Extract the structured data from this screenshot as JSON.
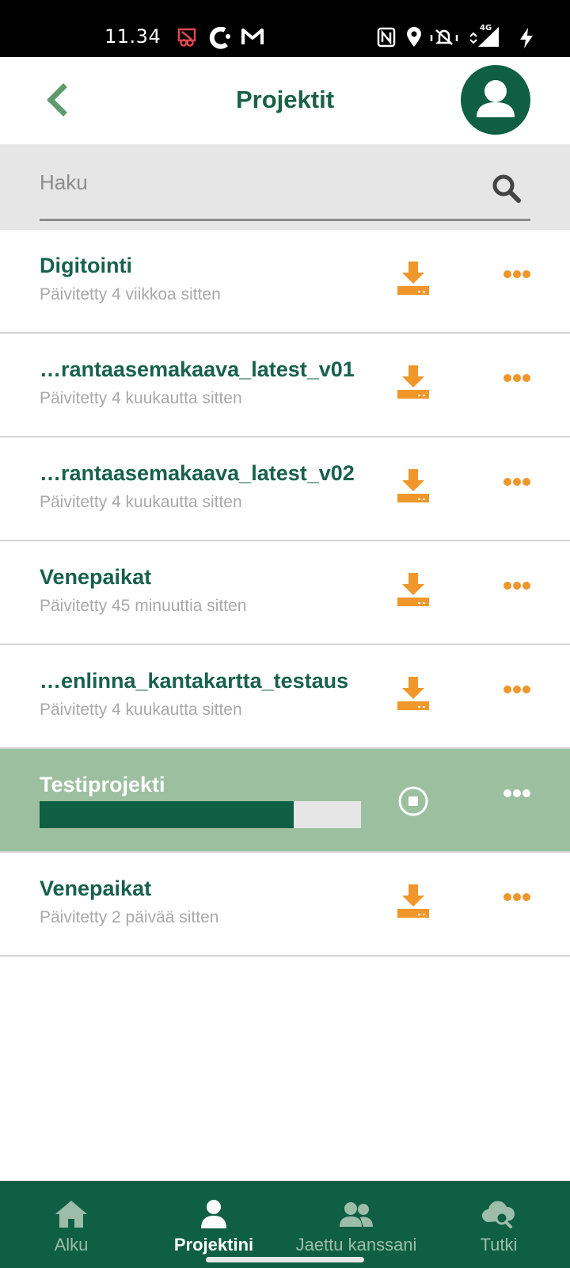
{
  "status_bar": {
    "time": "11.34",
    "icons": [
      "cast-off-icon",
      "c-app-icon",
      "gmail-icon",
      "nfc-icon",
      "location-icon",
      "vibrate-icon",
      "signal-4g-icon",
      "charging-icon"
    ]
  },
  "header": {
    "title": "Projektit",
    "back_icon": "chevron-left-icon",
    "avatar_icon": "user-avatar-icon"
  },
  "search": {
    "placeholder": "Haku",
    "value": ""
  },
  "projects": [
    {
      "name": "Digitointi",
      "updated": "Päivitetty 4 viikkoa sitten",
      "status": "download"
    },
    {
      "name": "…rantaasemakaava_latest_v01",
      "updated": "Päivitetty 4 kuukautta sitten",
      "status": "download"
    },
    {
      "name": "…rantaasemakaava_latest_v02",
      "updated": "Päivitetty 4 kuukautta sitten",
      "status": "download"
    },
    {
      "name": "Venepaikat",
      "updated": "Päivitetty 45 minuuttia sitten",
      "status": "download"
    },
    {
      "name": "…enlinna_kantakartta_testaus",
      "updated": "Päivitetty 4 kuukautta sitten",
      "status": "download"
    },
    {
      "name": "Testiprojekti",
      "updated": "",
      "status": "downloading",
      "progress": 0.79
    },
    {
      "name": "Venepaikat",
      "updated": "Päivitetty 2 päivää sitten",
      "status": "download"
    }
  ],
  "bottom_nav": {
    "items": [
      {
        "label": "Alku",
        "icon": "home-icon",
        "active": false
      },
      {
        "label": "Projektini",
        "icon": "person-icon",
        "active": true
      },
      {
        "label": "Jaettu kanssani",
        "icon": "people-icon",
        "active": false
      },
      {
        "label": "Tutki",
        "icon": "cloud-search-icon",
        "active": false
      }
    ]
  },
  "colors": {
    "brand_green": "#0f5f44",
    "title_green": "#1a6145",
    "accent_orange": "#f0962a",
    "active_row": "#9cc09f",
    "inactive_nav": "#9dbdaa"
  }
}
